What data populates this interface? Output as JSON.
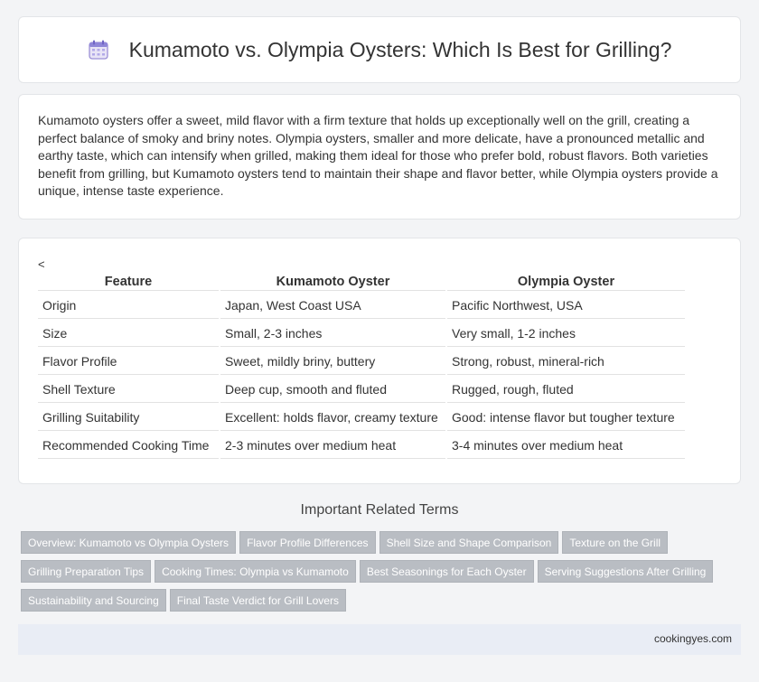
{
  "header": {
    "icon": "calendar-icon",
    "title": "Kumamoto vs. Olympia Oysters: Which Is Best for Grilling?"
  },
  "intro": {
    "text": "Kumamoto oysters offer a sweet, mild flavor with a firm texture that holds up exceptionally well on the grill, creating a perfect balance of smoky and briny notes. Olympia oysters, smaller and more delicate, have a pronounced metallic and earthy taste, which can intensify when grilled, making them ideal for those who prefer bold, robust flavors. Both varieties benefit from grilling, but Kumamoto oysters tend to maintain their shape and flavor better, while Olympia oysters provide a unique, intense taste experience."
  },
  "comparison": {
    "stray_char": "<",
    "headers": [
      "Feature",
      "Kumamoto Oyster",
      "Olympia Oyster"
    ],
    "rows": [
      [
        "Origin",
        "Japan, West Coast USA",
        "Pacific Northwest, USA"
      ],
      [
        "Size",
        "Small, 2-3 inches",
        "Very small, 1-2 inches"
      ],
      [
        "Flavor Profile",
        "Sweet, mildly briny, buttery",
        "Strong, robust, mineral-rich"
      ],
      [
        "Shell Texture",
        "Deep cup, smooth and fluted",
        "Rugged, rough, fluted"
      ],
      [
        "Grilling Suitability",
        "Excellent: holds flavor, creamy texture",
        "Good: intense flavor but tougher texture"
      ],
      [
        "Recommended Cooking Time",
        "2-3 minutes over medium heat",
        "3-4 minutes over medium heat"
      ]
    ]
  },
  "related": {
    "title": "Important Related Terms",
    "tags": [
      "Overview: Kumamoto vs Olympia Oysters",
      "Flavor Profile Differences",
      "Shell Size and Shape Comparison",
      "Texture on the Grill",
      "Grilling Preparation Tips",
      "Cooking Times: Olympia vs Kumamoto",
      "Best Seasonings for Each Oyster",
      "Serving Suggestions After Grilling",
      "Sustainability and Sourcing",
      "Final Taste Verdict for Grill Lovers"
    ]
  },
  "footer": {
    "site": "cookingyes.com"
  }
}
